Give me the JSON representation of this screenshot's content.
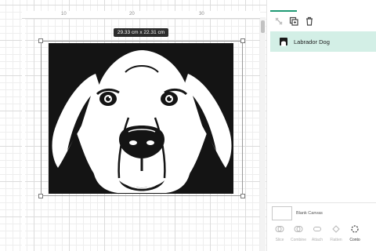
{
  "canvas": {
    "ruler_numbers": [
      "10",
      "20",
      "30"
    ],
    "size_label": "29.33  cm x 22.31  cm"
  },
  "image": {
    "name": "Labrador Dog",
    "icon": "dog-silhouette-icon"
  },
  "panel": {
    "tools": [
      {
        "name": "unlink-icon",
        "enabled": false
      },
      {
        "name": "duplicate-icon",
        "enabled": true
      },
      {
        "name": "delete-icon",
        "enabled": true
      }
    ],
    "layers": [
      {
        "label": "Labrador Dog",
        "selected": true
      }
    ],
    "blank_canvas_label": "Blank Canvas",
    "bottom_tools": [
      {
        "label": "Slice",
        "icon": "slice-icon"
      },
      {
        "label": "Combine",
        "icon": "combine-icon"
      },
      {
        "label": "Attach",
        "icon": "attach-icon"
      },
      {
        "label": "Flatten",
        "icon": "flatten-icon"
      },
      {
        "label": "Conto",
        "icon": "contour-icon"
      }
    ]
  },
  "colors": {
    "accent": "#1f9a74",
    "layer_selected_bg": "#d3efe6",
    "size_label_bg": "#2c2c2c"
  }
}
